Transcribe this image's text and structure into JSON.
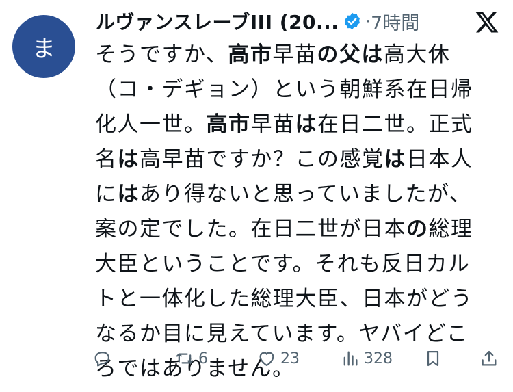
{
  "avatar": {
    "glyph": "ま",
    "color": "#2a4f93"
  },
  "header": {
    "name": "ルヴァンスレーブIII (20...",
    "separator": "·",
    "time": "7時間",
    "verified_color": "#1d9bf0"
  },
  "post": {
    "segments": [
      {
        "t": "そうですか、"
      },
      {
        "t": "高市",
        "b": true
      },
      {
        "t": "早苗"
      },
      {
        "t": "の父は",
        "b": true
      },
      {
        "t": "高大休（コ・デギョン）という朝鮮系在日帰化人一世。"
      },
      {
        "t": "高市",
        "b": true
      },
      {
        "t": "早苗"
      },
      {
        "t": "は",
        "b": true
      },
      {
        "t": "在日二世。正式名"
      },
      {
        "t": "は",
        "b": true
      },
      {
        "t": "高早苗ですか？この感覚"
      },
      {
        "t": "は",
        "b": true
      },
      {
        "t": "日本人に"
      },
      {
        "t": "は",
        "b": true
      },
      {
        "t": "あり得ないと思っていましたが、案の定でした。在日二世が日本"
      },
      {
        "t": "の",
        "b": true
      },
      {
        "t": "総理大臣ということです。それも反日カルトと一体化した総理大臣、日本がどうなるか目に見えています。ヤバイどころではありません。"
      }
    ]
  },
  "actions": {
    "reply": "",
    "repost": "6",
    "like": "23",
    "views": "328"
  }
}
